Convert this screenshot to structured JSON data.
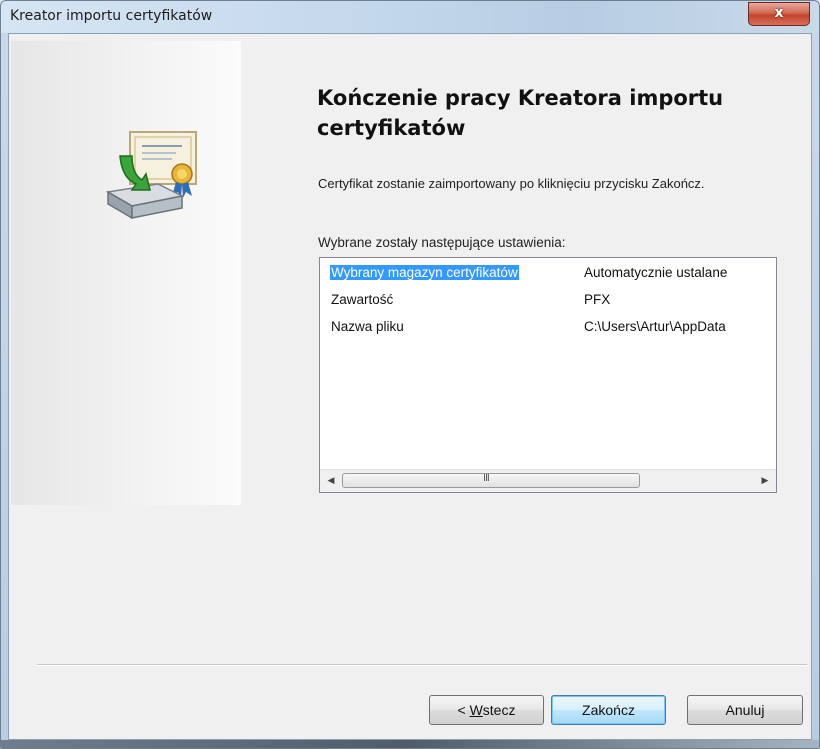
{
  "window": {
    "title": "Kreator importu certyfikatów",
    "close_label": "x"
  },
  "icon": "certificate-import-icon",
  "main": {
    "heading": "Kończenie pracy Kreatora importu certyfikatów",
    "description": "Certyfikat zostanie zaimportowany po kliknięciu przycisku Zakończ.",
    "settings_label": "Wybrane zostały następujące ustawienia:",
    "settings": [
      {
        "name": "Wybrany magazyn certyfikatów",
        "value": "Automatycznie ustalane"
      },
      {
        "name": "Zawartość",
        "value": "PFX"
      },
      {
        "name": "Nazwa pliku",
        "value": "C:\\Users\\Artur\\AppData"
      }
    ],
    "scroll_grip": "III"
  },
  "buttons": {
    "back_prefix": "< ",
    "back_mnemonic": "W",
    "back_rest": "stecz",
    "finish": "Zakończ",
    "cancel": "Anuluj"
  },
  "colors": {
    "selection": "#3399ff",
    "close_button": "#c3432b"
  }
}
